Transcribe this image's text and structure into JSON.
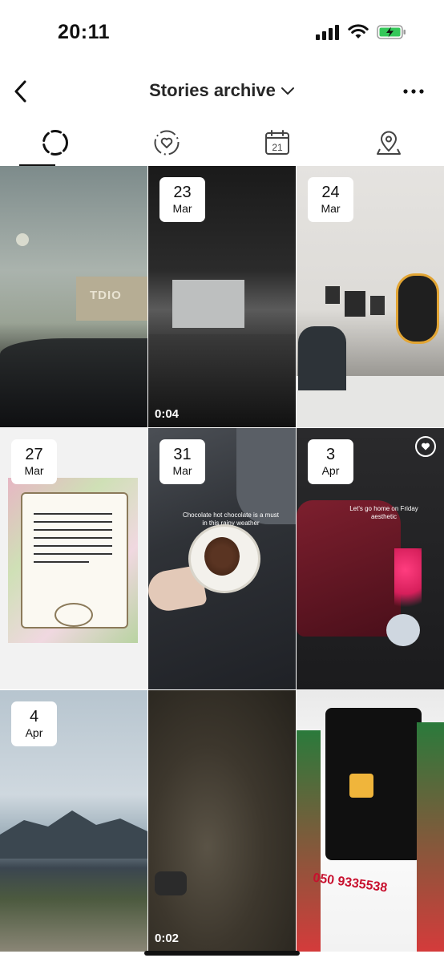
{
  "status_bar": {
    "time": "20:11",
    "icons": [
      "signal-icon",
      "wifi-icon",
      "battery-charging-icon"
    ],
    "battery_color": "#34c759"
  },
  "header": {
    "title": "Stories archive",
    "back_icon": "chevron-left-icon",
    "title_chevron_icon": "chevron-down-icon",
    "more_icon": "more-horizontal-icon"
  },
  "tabs": [
    {
      "name": "stories",
      "icon": "story-ring-icon",
      "active": true
    },
    {
      "name": "highlights",
      "icon": "heart-ring-icon",
      "active": false
    },
    {
      "name": "calendar",
      "icon": "calendar-icon",
      "calendar_day": "21",
      "active": false
    },
    {
      "name": "map",
      "icon": "location-pin-icon",
      "active": false
    }
  ],
  "stories": [
    {
      "day": "",
      "month": "",
      "duration": "",
      "has_heart": false
    },
    {
      "day": "23",
      "month": "Mar",
      "duration": "0:04",
      "has_heart": false
    },
    {
      "day": "24",
      "month": "Mar",
      "duration": "",
      "has_heart": false
    },
    {
      "day": "27",
      "month": "Mar",
      "duration": "",
      "has_heart": false
    },
    {
      "day": "31",
      "month": "Mar",
      "duration": "",
      "has_heart": false,
      "caption": "Chocolate hot chocolate is a must in this rainy weather"
    },
    {
      "day": "3",
      "month": "Apr",
      "duration": "",
      "has_heart": true,
      "caption": "Let's go home on Friday aesthetic"
    },
    {
      "day": "4",
      "month": "Apr",
      "duration": "",
      "has_heart": false
    },
    {
      "day": "",
      "month": "",
      "duration": "0:02",
      "has_heart": false
    },
    {
      "day": "",
      "month": "",
      "duration": "",
      "has_heart": false,
      "sign_text": "050 9335538"
    }
  ]
}
